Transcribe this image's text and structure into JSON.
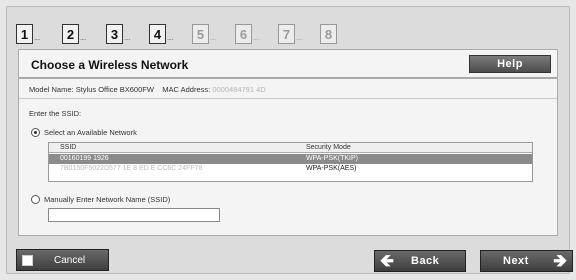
{
  "steps": [
    {
      "num": "1",
      "dots": "....",
      "active": true
    },
    {
      "num": "2",
      "dots": "....",
      "active": true
    },
    {
      "num": "3",
      "dots": "....",
      "active": true
    },
    {
      "num": "4",
      "dots": "....",
      "active": true
    },
    {
      "num": "5",
      "dots": "....",
      "active": false
    },
    {
      "num": "6",
      "dots": "....",
      "active": false
    },
    {
      "num": "7",
      "dots": "....",
      "active": false
    },
    {
      "num": "8",
      "dots": "",
      "active": false
    }
  ],
  "panel": {
    "title": "Choose a Wireless Network",
    "help_label": "Help",
    "model_label": "Model Name:",
    "model_value": "Stylus Office BX600FW",
    "mac_label": "MAC Address:",
    "mac_value": "0000484791 4D",
    "enter_ssid": "Enter the SSID:",
    "select_available": "Select an Available Network",
    "manual_enter": "Manually Enter Network Name (SSID)",
    "ssid_input_value": ""
  },
  "table": {
    "headers": [
      "SSID",
      "Security Mode"
    ],
    "rows": [
      {
        "ssid": "00160199 1926",
        "security": "WPA-PSK(TKIP)",
        "selected": true
      },
      {
        "ssid": "7B0150F5022D577 1E 8 ED E CC6C 24FF78",
        "security": "WPA-PSK(AES)",
        "selected": false
      }
    ]
  },
  "footer": {
    "cancel_label": "Cancel",
    "back_label": "Back",
    "next_label": "Next"
  },
  "colors": {
    "panel_bg": "#f4f4f4",
    "button_dark": "#4d4d4d",
    "selected_row": "#8b8b8b"
  }
}
